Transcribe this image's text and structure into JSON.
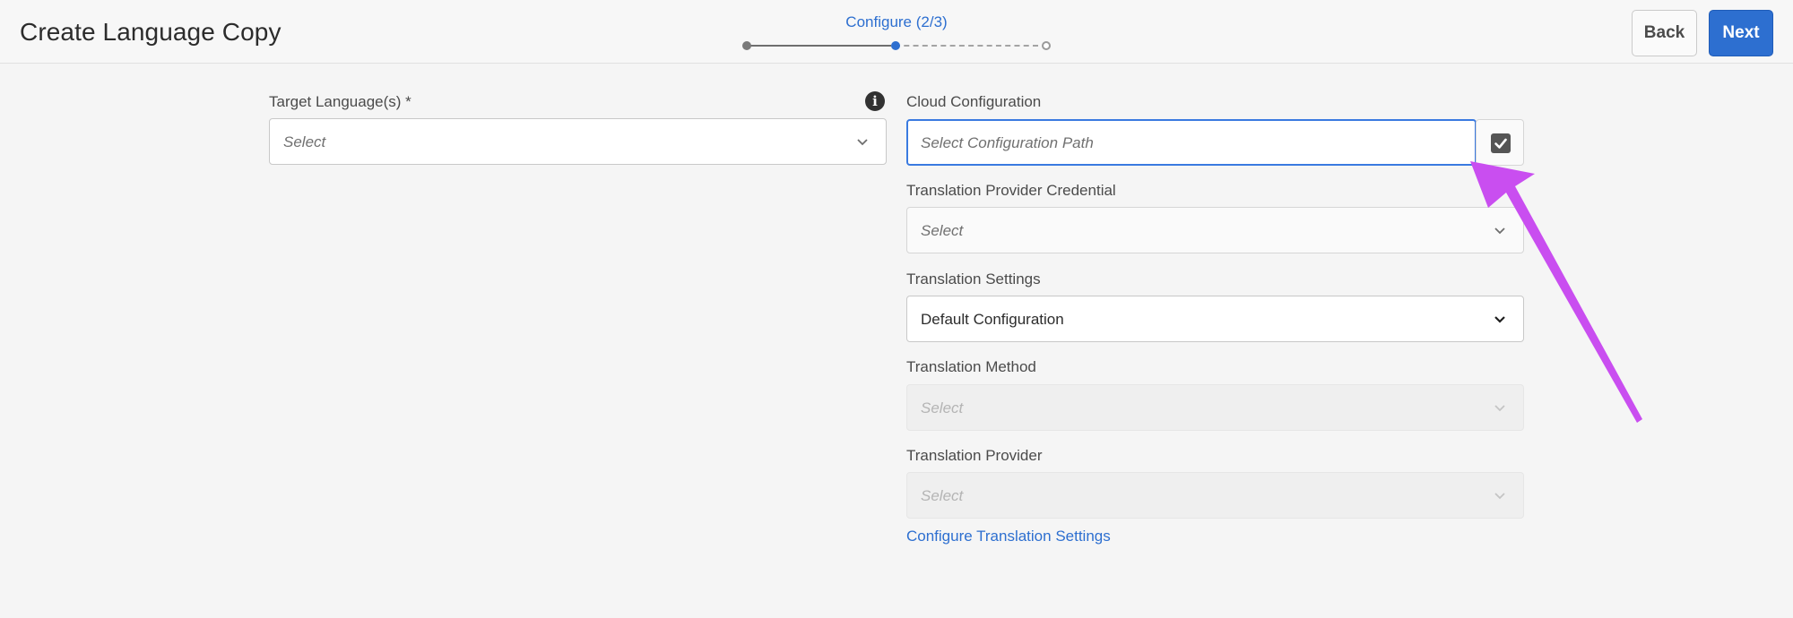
{
  "header": {
    "title": "Create Language Copy",
    "step_label": "Configure (2/3)",
    "back_label": "Back",
    "next_label": "Next"
  },
  "stepper": {
    "current_step": 2,
    "total_steps": 3
  },
  "target_language": {
    "label": "Target Language(s) *",
    "placeholder": "Select",
    "info_icon": "info-icon"
  },
  "cloud_configuration": {
    "label": "Cloud Configuration",
    "placeholder": "Select Configuration Path",
    "picker_icon": "checkbox-icon"
  },
  "credential": {
    "label": "Translation Provider Credential",
    "placeholder": "Select"
  },
  "settings": {
    "label": "Translation Settings",
    "value": "Default Configuration"
  },
  "method": {
    "label": "Translation Method",
    "placeholder": "Select"
  },
  "provider": {
    "label": "Translation Provider",
    "placeholder": "Select"
  },
  "configure_link": "Configure Translation Settings",
  "colors": {
    "accent": "#2d6fd0",
    "annotation_arrow": "#c94ef0",
    "background": "#f5f5f5"
  }
}
